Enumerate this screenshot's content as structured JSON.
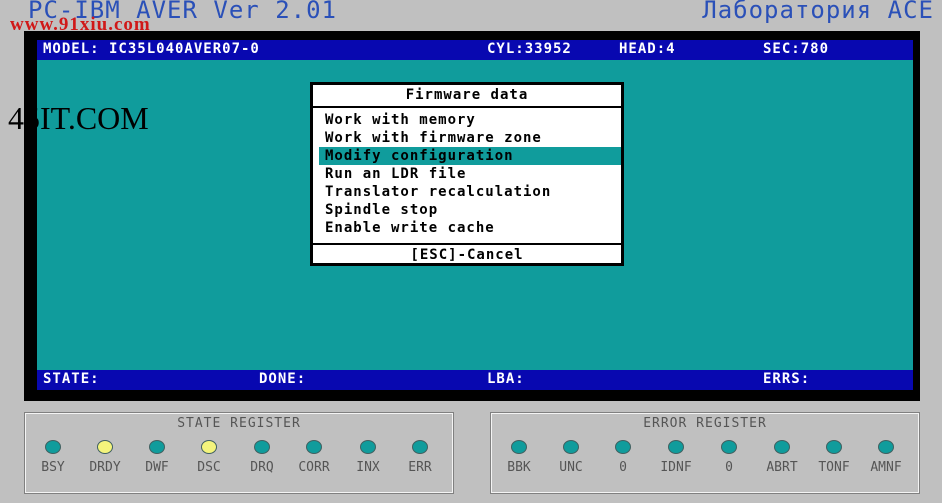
{
  "header": {
    "app_title": "PC-IBM AVER Ver 2.01",
    "lab_title": "Лаборатория ACE"
  },
  "watermarks": {
    "url": "www.91xiu.com",
    "site": "45IT.COM"
  },
  "drive_info": {
    "model": "MODEL: IC35L040AVER07-0",
    "cyl": "CYL:33952",
    "head": "HEAD:4",
    "sec": "SEC:780"
  },
  "status_bar": {
    "state": "STATE:",
    "done": "DONE:",
    "lba": "LBA:",
    "errs": "ERRS:"
  },
  "dialog": {
    "title": "Firmware data",
    "items": [
      {
        "label": "Work with memory",
        "selected": false
      },
      {
        "label": "Work with firmware zone",
        "selected": false
      },
      {
        "label": "Modify configuration",
        "selected": true
      },
      {
        "label": "Run an LDR file",
        "selected": false
      },
      {
        "label": "Translator recalculation",
        "selected": false
      },
      {
        "label": "Spindle stop",
        "selected": false
      },
      {
        "label": "Enable write cache",
        "selected": false
      }
    ],
    "cancel": "[ESC]-Cancel"
  },
  "colors": {
    "led_on": "#f4f47c",
    "led_off": "#109c9c",
    "screen": "#109c9c",
    "bar": "#0808b0"
  },
  "state_register": {
    "title": "STATE REGISTER",
    "leds": [
      {
        "label": "BSY",
        "on": false
      },
      {
        "label": "DRDY",
        "on": true
      },
      {
        "label": "DWF",
        "on": false
      },
      {
        "label": "DSC",
        "on": true
      },
      {
        "label": "DRQ",
        "on": false
      },
      {
        "label": "CORR",
        "on": false
      },
      {
        "label": "INX",
        "on": false
      },
      {
        "label": "ERR",
        "on": false
      }
    ]
  },
  "error_register": {
    "title": "ERROR REGISTER",
    "leds": [
      {
        "label": "BBK",
        "on": false
      },
      {
        "label": "UNC",
        "on": false
      },
      {
        "label": "0",
        "on": false
      },
      {
        "label": "IDNF",
        "on": false
      },
      {
        "label": "0",
        "on": false
      },
      {
        "label": "ABRT",
        "on": false
      },
      {
        "label": "TONF",
        "on": false
      },
      {
        "label": "AMNF",
        "on": false
      }
    ]
  }
}
